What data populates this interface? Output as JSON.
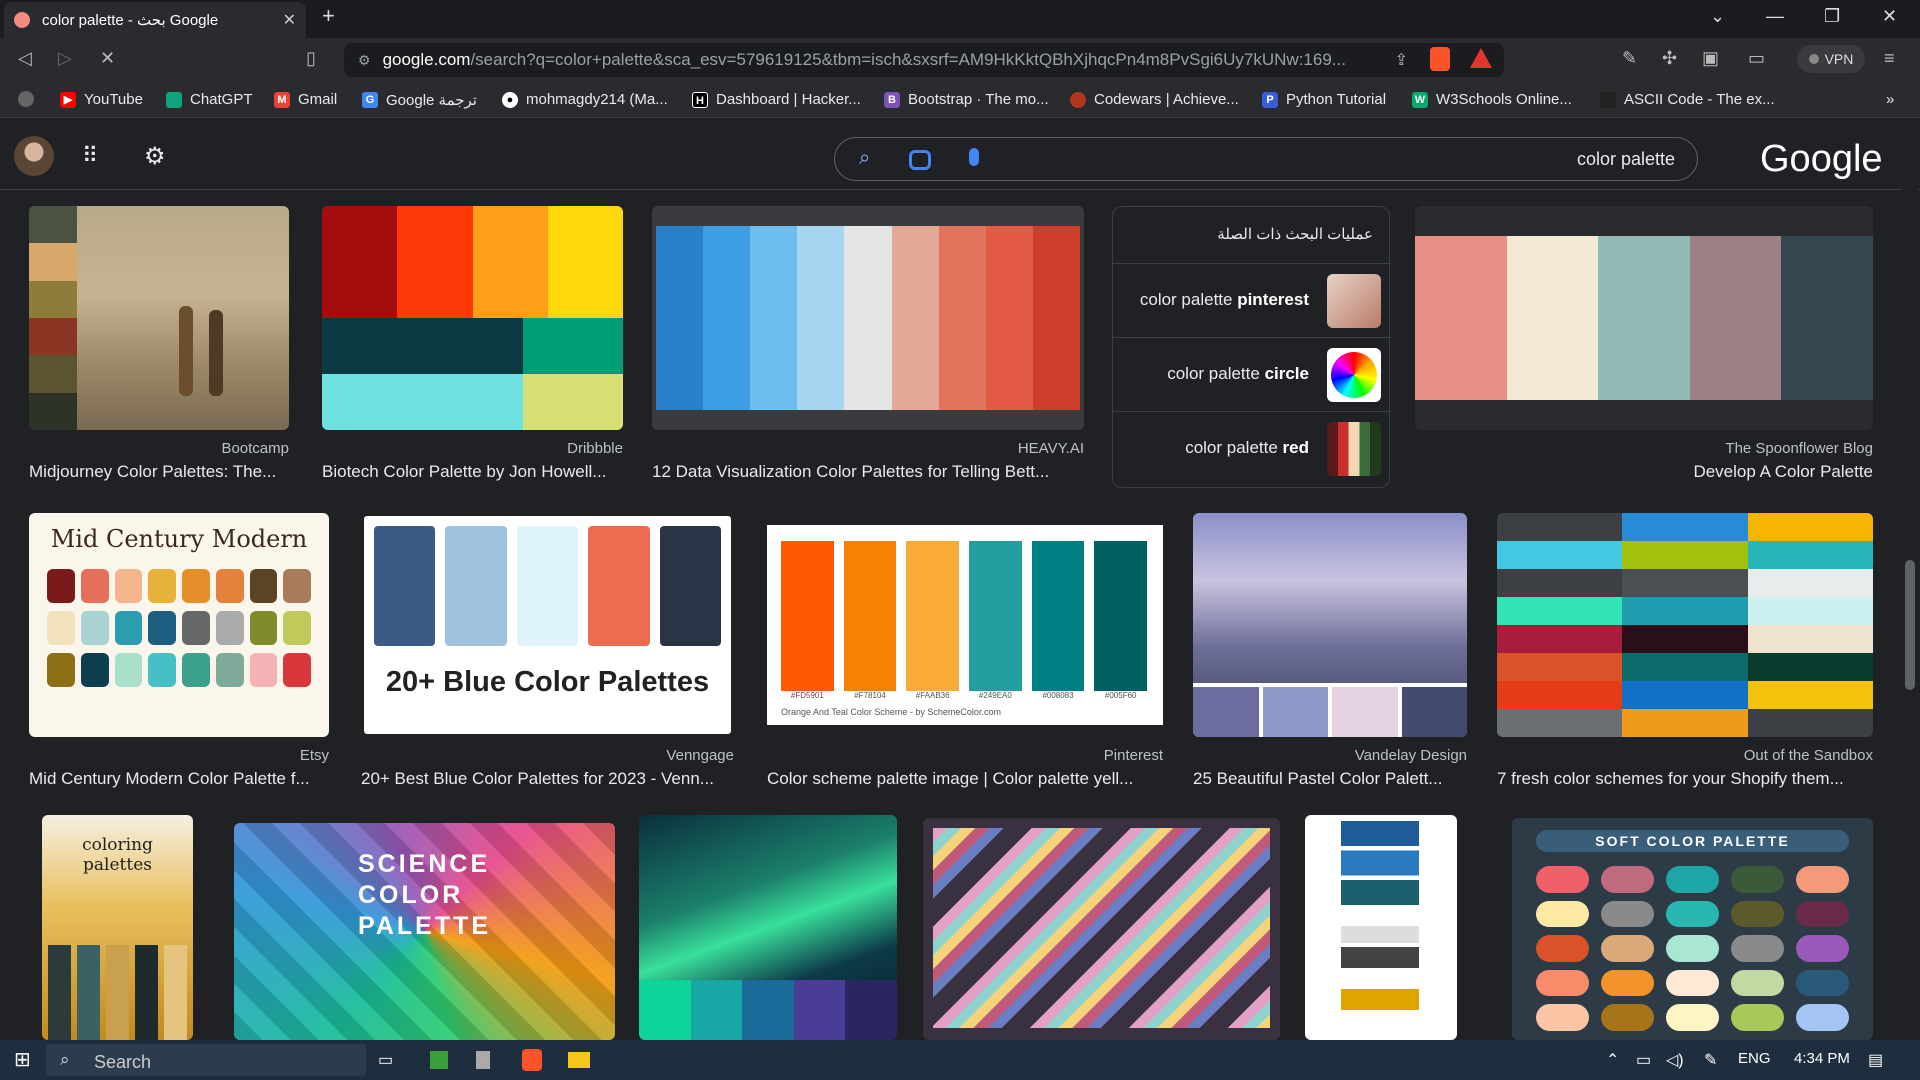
{
  "tab": {
    "title": "color palette - بحث Google"
  },
  "address": {
    "domain": "google.com",
    "path": "/search?q=color+palette&sca_esv=579619125&tbm=isch&sxsrf=AM9HkKktQBhXjhqcPn4m8PvSgi6Uy7kUNw:169..."
  },
  "vpn": "VPN",
  "bookmarks": [
    "YouTube",
    "ChatGPT",
    "Gmail",
    "Google ترجمة",
    "mohmagdy214 (Ma...",
    "Dashboard | Hacker...",
    "Bootstrap · The mo...",
    "Codewars | Achieve...",
    "Python Tutorial",
    "W3Schools Online...",
    "ASCII Code - The ex..."
  ],
  "search": {
    "query": "color palette"
  },
  "logo": "Google",
  "related": {
    "heading": "عمليات البحث ذات الصلة",
    "items": [
      {
        "prefix": "color palette ",
        "bold": "pinterest"
      },
      {
        "prefix": "color palette ",
        "bold": "circle"
      },
      {
        "prefix": "color palette ",
        "bold": "red"
      }
    ]
  },
  "results": [
    {
      "source": "Bootcamp",
      "title": "Midjourney Color Palettes: The..."
    },
    {
      "source": "Dribbble",
      "title": "Biotech Color Palette by Jon Howell..."
    },
    {
      "source": "HEAVY.AI",
      "title": "12 Data Visualization Color Palettes for Telling Bett..."
    },
    {
      "source": "The Spoonflower Blog",
      "title": "Develop A Color Palette"
    },
    {
      "source": "Etsy",
      "title": "Mid Century Modern Color Palette f..."
    },
    {
      "source": "Venngage",
      "title": "20+ Best Blue Color Palettes for 2023 - Venn..."
    },
    {
      "source": "Pinterest",
      "title": "Color scheme palette image | Color palette yell..."
    },
    {
      "source": "Vandelay Design",
      "title": "25 Beautiful Pastel Color Palett..."
    },
    {
      "source": "Out of the Sandbox",
      "title": "7 fresh color schemes for your Shopify them..."
    }
  ],
  "image_text": {
    "mcm": "Mid Century Modern",
    "blue": "20+ Blue Color Palettes",
    "science": "SCIENCE COLOR PALETTE",
    "soft": "SOFT COLOR PALETTE",
    "coloring": "coloring palettes",
    "teal": "Orange And Teal Color Scheme - by SchemeColor.com",
    "teal_codes": [
      "#FD5901",
      "#F78104",
      "#FAAB36",
      "#249EA0",
      "#008083",
      "#005F60"
    ]
  },
  "taskbar": {
    "search": "Search",
    "lang": "ENG",
    "time": "4:34 PM"
  },
  "colors": {
    "bg": "#202124",
    "taskbar": "#1f2e3f"
  }
}
